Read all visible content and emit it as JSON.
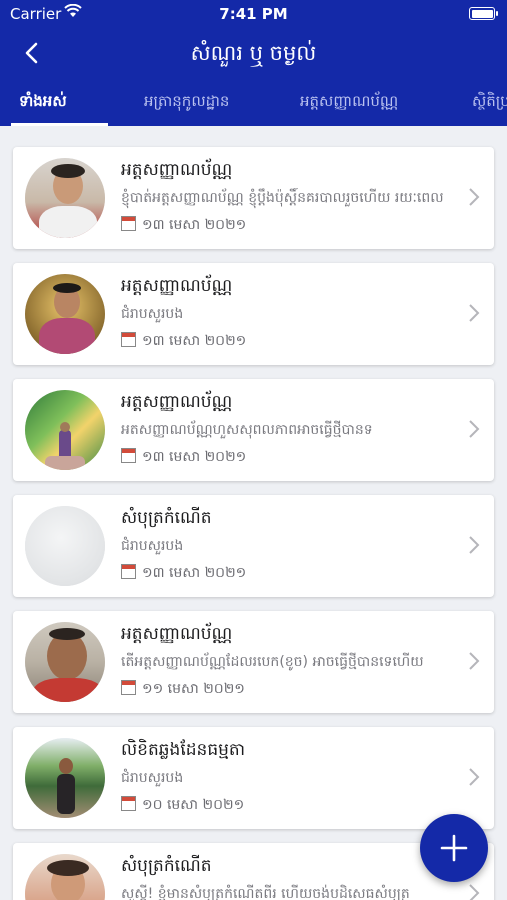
{
  "status_bar": {
    "carrier": "Carrier",
    "time": "7:41 PM"
  },
  "nav": {
    "title": "សំណួរ ឬ ចម្ងល់"
  },
  "tabs": [
    {
      "label": "ទាំងអស់",
      "active": true
    },
    {
      "label": "អត្រានុកូលដ្ឋាន",
      "active": false
    },
    {
      "label": "អត្តសញ្ញាណប័ណ្ណ",
      "active": false
    },
    {
      "label": "ស្ថិតិប្រ",
      "active": false
    }
  ],
  "items": [
    {
      "title": "អត្តសញ្ញាណប័ណ្ណ",
      "subtitle": "ខ្ញុំបាត់អត្តសញ្ញាណប័ណ្ណ ខ្ញុំប្ដឹងប៉ុស្ដិ៍នគរបាលរួចហើយ រយៈពេល",
      "date": "១៣ មេសា ២០២១"
    },
    {
      "title": "អត្តសញ្ញាណប័ណ្ណ",
      "subtitle": "ជំរាបសួរបង",
      "date": "១៣ មេសា ២០២១"
    },
    {
      "title": "អត្តសញ្ញាណប័ណ្ណ",
      "subtitle": "អតសញ្ញាណប័ណ្ណហួសសុពលភាពអាចធ្វើថ្មីបានទ",
      "date": "១៣ មេសា ២០២១"
    },
    {
      "title": "សំបុត្រកំណើត",
      "subtitle": "ជំរាបសួរបង",
      "date": "១៣ មេសា ២០២១"
    },
    {
      "title": "អត្តសញ្ញាណប័ណ្ណ",
      "subtitle": "តើអត្តសញ្ញាណប័ណ្ណដែលរបេក(ខូច) អាចធ្វើថ្មីបានទេហើយ",
      "date": "១១ មេសា ២០២១"
    },
    {
      "title": "លិខិតឆ្លងដែនធម្មតា",
      "subtitle": "ជំរាបសួរបង",
      "date": "១០ មេសា ២០២១"
    },
    {
      "title": "សំបុត្រកំណើត",
      "subtitle": "សួស្ដី! ខ្ញុំមានសំបុត្រកំណើតពីរ ហើយចង់បដិសេធសំបុត្រ",
      "date": ""
    }
  ],
  "colors": {
    "primary": "#1429a8",
    "background": "#eef0f4",
    "card": "#ffffff"
  },
  "icons": {
    "back": "back-chevron-icon",
    "calendar": "calendar-icon",
    "row": "chevron-right-icon",
    "fab": "plus-icon"
  }
}
